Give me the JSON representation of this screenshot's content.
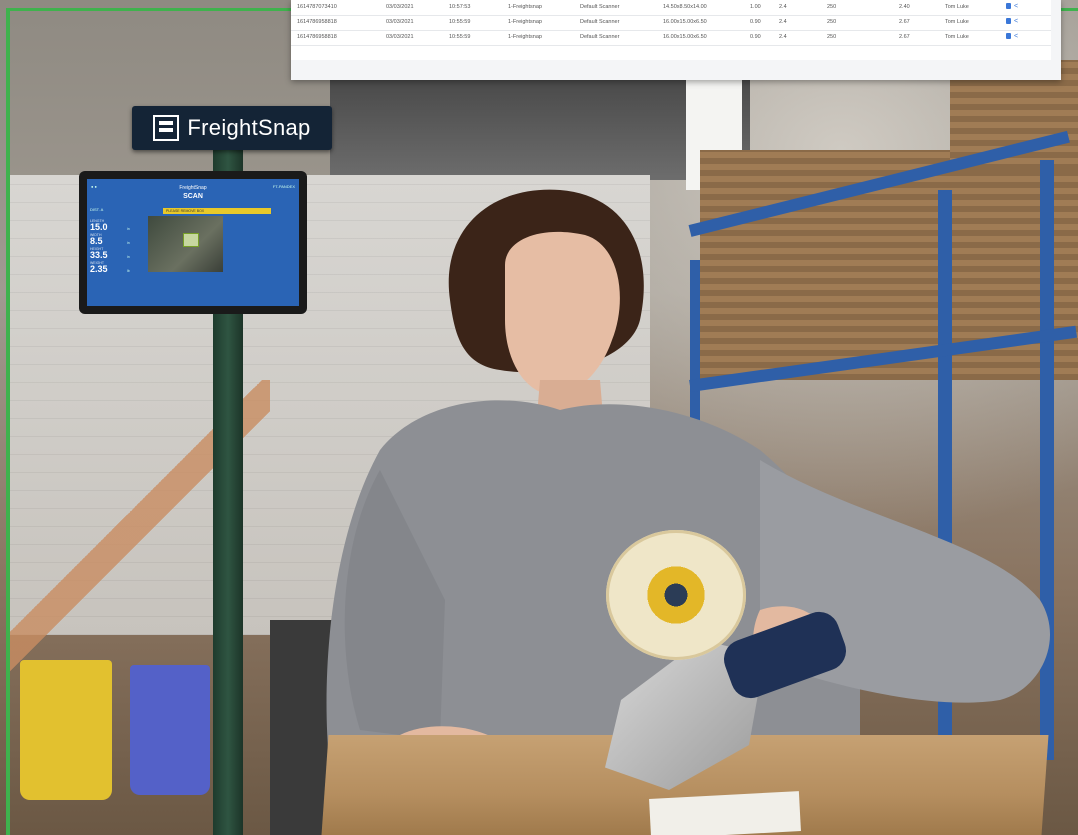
{
  "sign": {
    "brand": "FreightSnap"
  },
  "kiosk": {
    "brand": "FreightSnap",
    "screen_title": "SCAN",
    "banner": "PLEASE REMOVE BOX",
    "top_right": "FT-PANDEX",
    "left_field": "DIST. A",
    "metrics": [
      {
        "label": "LENGTH",
        "value": "15.0",
        "unit": "in"
      },
      {
        "label": "WIDTH",
        "value": "8.5",
        "unit": "in"
      },
      {
        "label": "HEIGHT",
        "value": "33.5",
        "unit": "in"
      },
      {
        "label": "WEIGHT",
        "value": "2.35",
        "unit": "lb"
      }
    ]
  },
  "table": {
    "rows": [
      {
        "id": "1614787073410",
        "date": "03/03/2021",
        "time": "10:57:53",
        "device": "1-Freightsnap",
        "scanner": "Default Scanner",
        "dims": "14.50x8.50x14.00",
        "a": "1.00",
        "b": "2.4",
        "c": "250",
        "d": "2.40",
        "user": "Tom Luke"
      },
      {
        "id": "1614786958818",
        "date": "03/03/2021",
        "time": "10:55:59",
        "device": "1-Freightsnap",
        "scanner": "Default Scanner",
        "dims": "16.00x15.00x6.50",
        "a": "0.90",
        "b": "2.4",
        "c": "250",
        "d": "2.67",
        "user": "Tom Luke"
      },
      {
        "id": "1614786958818",
        "date": "03/03/2021",
        "time": "10:55:59",
        "device": "1-Freightsnap",
        "scanner": "Default Scanner",
        "dims": "16.00x15.00x6.50",
        "a": "0.90",
        "b": "2.4",
        "c": "250",
        "d": "2.67",
        "user": "Tom Luke"
      }
    ]
  },
  "colors": {
    "accent_green": "#3fb24d",
    "kiosk_blue": "#2a64b5",
    "rack_blue": "#2f5fa8",
    "action_blue": "#3a77d8"
  }
}
